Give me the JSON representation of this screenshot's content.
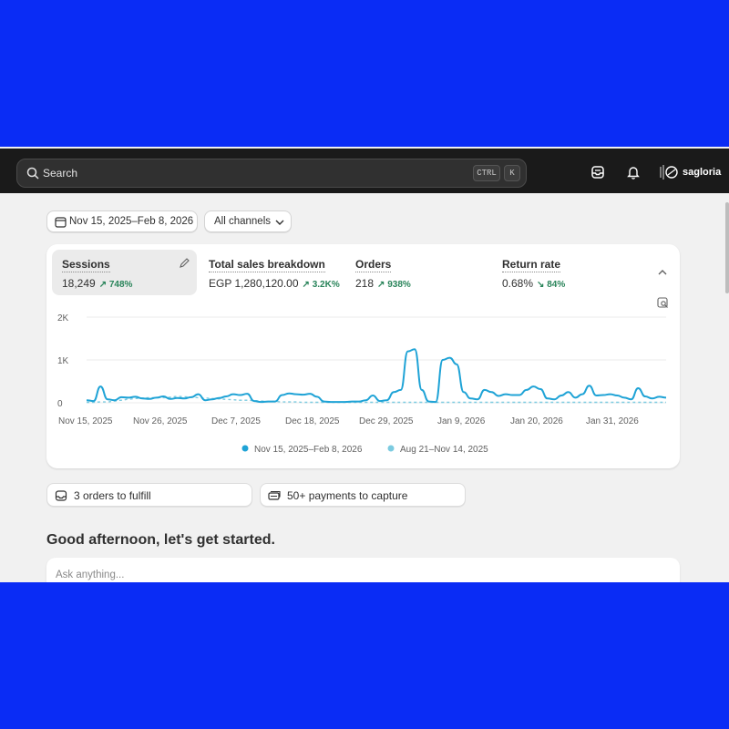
{
  "topbar": {
    "search_placeholder": "Search",
    "shortcut_ctrl": "CTRL",
    "shortcut_k": "K",
    "store_name": "sagloria",
    "icons": [
      "search-icon",
      "inbox-icon",
      "bell-icon",
      "store-logo"
    ]
  },
  "filters": {
    "date_range": "Nov 15, 2025–Feb 8, 2026",
    "channel": "All channels"
  },
  "metrics": [
    {
      "label": "Sessions",
      "value": "18,249",
      "change": "748%",
      "active": true
    },
    {
      "label": "Total sales breakdown",
      "value": "EGP 1,280,120.00",
      "change": "3.2K%"
    },
    {
      "label": "Orders",
      "value": "218",
      "change": "938%"
    },
    {
      "label": "Return rate",
      "value": "0.68%",
      "change": "84%",
      "direction": "down"
    }
  ],
  "chart_data": {
    "type": "line",
    "y_ticks": [
      "2K",
      "1K",
      "0"
    ],
    "ylim": [
      0,
      2000
    ],
    "x_ticks": [
      "Nov 15, 2025",
      "Nov 26, 2025",
      "Dec 7, 2025",
      "Dec 18, 2025",
      "Dec 29, 2025",
      "Jan 9, 2026",
      "Jan 20, 2026",
      "Jan 31, 2026"
    ],
    "grid": true,
    "legend_position": "bottom-center",
    "series": [
      {
        "name": "Nov 15, 2025–Feb 8, 2026",
        "color": "#1fa3d6",
        "style": "solid",
        "values": [
          60,
          40,
          380,
          80,
          60,
          130,
          120,
          140,
          100,
          90,
          120,
          150,
          90,
          110,
          100,
          130,
          200,
          60,
          80,
          110,
          150,
          200,
          180,
          210,
          40,
          20,
          30,
          30,
          180,
          220,
          200,
          190,
          210,
          140,
          30,
          20,
          20,
          20,
          30,
          30,
          60,
          170,
          40,
          60,
          250,
          300,
          1200,
          1250,
          300,
          30,
          20,
          1000,
          1050,
          900,
          250,
          100,
          80,
          300,
          250,
          160,
          200,
          180,
          180,
          300,
          380,
          320,
          100,
          80,
          170,
          250,
          120,
          200,
          400,
          170,
          180,
          200,
          170,
          120,
          80,
          340,
          150,
          100,
          140,
          120
        ]
      },
      {
        "name": "Aug 21–Nov 14, 2025",
        "color": "#7ccbe0",
        "style": "dashed",
        "values": [
          10,
          10,
          20,
          20,
          40,
          60,
          80,
          100,
          110,
          120,
          120,
          120,
          130,
          150,
          140,
          130,
          120,
          110,
          100,
          90,
          80,
          70,
          60,
          60,
          50,
          40,
          30,
          30,
          20,
          20,
          20,
          10,
          10,
          10,
          10,
          10,
          10,
          10,
          10,
          10,
          10,
          10,
          10,
          10,
          10,
          10,
          10,
          10,
          10,
          10,
          10,
          10,
          10,
          10,
          10,
          10,
          10,
          10,
          10,
          10,
          10,
          10,
          10,
          10,
          10,
          10,
          10,
          10,
          10,
          10,
          10,
          10,
          10,
          10,
          10,
          10,
          10,
          10,
          10,
          10,
          10,
          10,
          10,
          10
        ]
      }
    ]
  },
  "tasks": [
    {
      "label": "3 orders to fulfill",
      "icon": "inbox-icon"
    },
    {
      "label": "50+ payments to capture",
      "icon": "money-icon"
    }
  ],
  "greeting": "Good afternoon, let's get started.",
  "ask_placeholder": "Ask anything..."
}
